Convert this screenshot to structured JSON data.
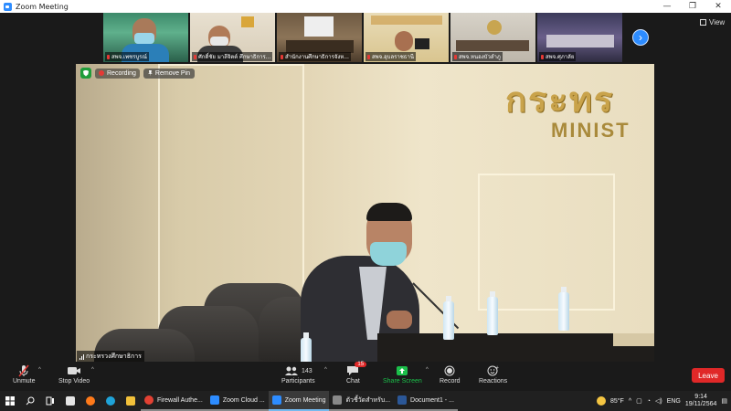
{
  "window": {
    "title": "Zoom Meeting",
    "controls": [
      "—",
      "❐",
      "✕"
    ]
  },
  "gallery": {
    "thumbnails": [
      {
        "name": "สพจ.เพชรบูรณ์",
        "muted": true
      },
      {
        "name": "ศักดิ์ชัย มาลีจิตต์ ศึกษาธิการ...",
        "muted": true
      },
      {
        "name": "สำนักงานศึกษาธิการจังห...",
        "muted": true
      },
      {
        "name": "สพจ.อุบลราชธานี",
        "muted": true
      },
      {
        "name": "สพจ.หนองบัวลำภู",
        "muted": true
      },
      {
        "name": "สพจ.ศุภาลัย",
        "muted": true
      }
    ],
    "view_label": "View"
  },
  "main": {
    "recording_label": "Recording",
    "remove_pin_label": "Remove Pin",
    "speaker_name": "กระทรวงศึกษาธิการ",
    "sign_thai": "กระทร",
    "sign_en": "MINIST"
  },
  "toolbar": {
    "unmute": "Unmute",
    "stop_video": "Stop Video",
    "participants": "Participants",
    "participants_count": "143",
    "chat": "Chat",
    "chat_badge": "15",
    "share_screen": "Share Screen",
    "record": "Record",
    "reactions": "Reactions",
    "leave": "Leave"
  },
  "taskbar": {
    "apps": [
      {
        "label": "Firewall Authe...",
        "state": "open"
      },
      {
        "label": "Zoom Cloud ...",
        "state": "open"
      },
      {
        "label": "Zoom Meeting",
        "state": "active"
      },
      {
        "label": "ตัวชี้วัดสำหรับ...",
        "state": "open"
      },
      {
        "label": "Document1 - ...",
        "state": "open"
      }
    ],
    "weather": "85°F",
    "lang": "ENG",
    "time": "9:14",
    "date": "19/11/2564"
  },
  "colors": {
    "accent": "#2d8cff",
    "leave": "#e02828",
    "share_green": "#1bbf4a"
  }
}
